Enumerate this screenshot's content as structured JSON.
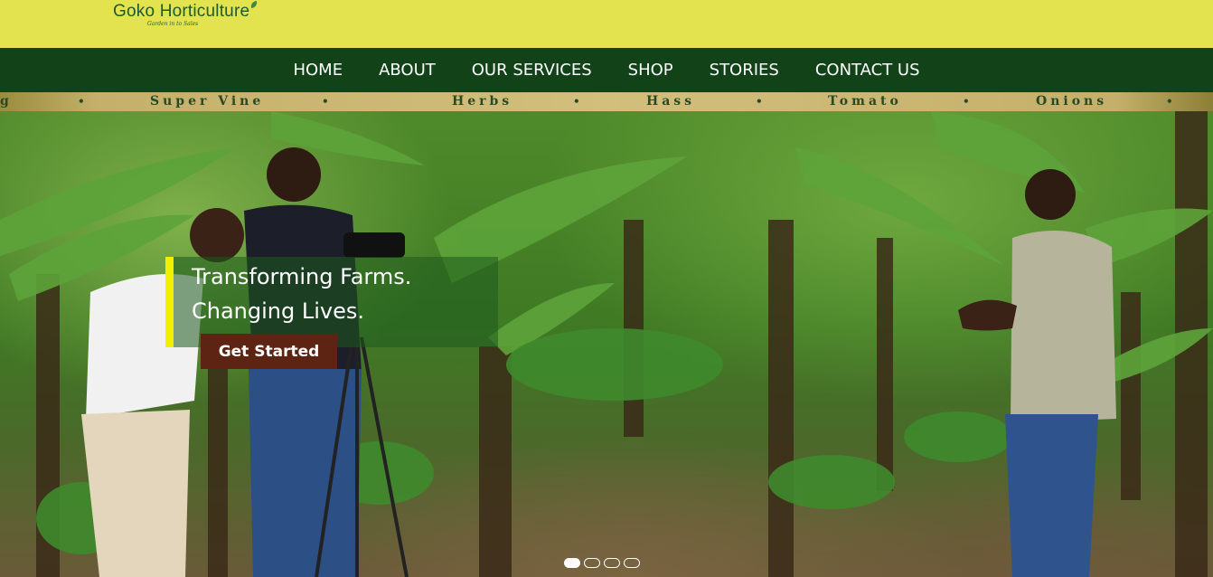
{
  "brand": {
    "name": "Goko Horticulture",
    "tagline": "Garden in to Sales"
  },
  "nav": {
    "items": [
      {
        "label": "HOME"
      },
      {
        "label": "ABOUT"
      },
      {
        "label": "OUR SERVICES"
      },
      {
        "label": "SHOP"
      },
      {
        "label": "STORIES"
      },
      {
        "label": "CONTACT US"
      }
    ]
  },
  "ticker": {
    "items": [
      "g",
      "Super Vine",
      "Herbs",
      "Hass",
      "Tomato",
      "Onions"
    ],
    "separator": "•"
  },
  "hero": {
    "headline_line1": "Transforming Farms.",
    "headline_line2": "Changing Lives.",
    "cta_label": "Get Started",
    "slide_count": 4,
    "active_slide": 1
  },
  "colors": {
    "topbar": "#e3e34f",
    "nav": "#124217",
    "accent": "#f0f000",
    "cta": "#5e2413"
  }
}
